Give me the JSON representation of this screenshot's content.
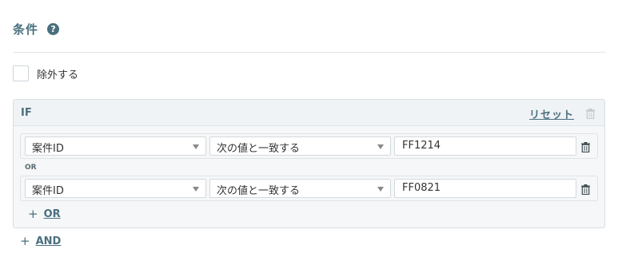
{
  "section": {
    "title": "条件",
    "help_icon": "?"
  },
  "exclude": {
    "label": "除外する",
    "checked": false
  },
  "if_block": {
    "label": "IF",
    "reset_label": "リセット",
    "conditions": [
      {
        "field": "案件ID",
        "operator": "次の値と一致する",
        "value": "FF1214"
      },
      {
        "field": "案件ID",
        "operator": "次の値と一致する",
        "value": "FF0821"
      }
    ],
    "or_separator": "OR",
    "add_or_plus": "+",
    "add_or_label": "OR"
  },
  "add_and_plus": "+",
  "add_and_label": "AND",
  "colors": {
    "accent": "#4a6f7e",
    "border": "#d8dee2",
    "panel_bg": "#f5f7f8"
  },
  "icons": {
    "help": "help-circle-icon",
    "trash": "trash-icon",
    "dropdown": "caret-down-icon"
  }
}
